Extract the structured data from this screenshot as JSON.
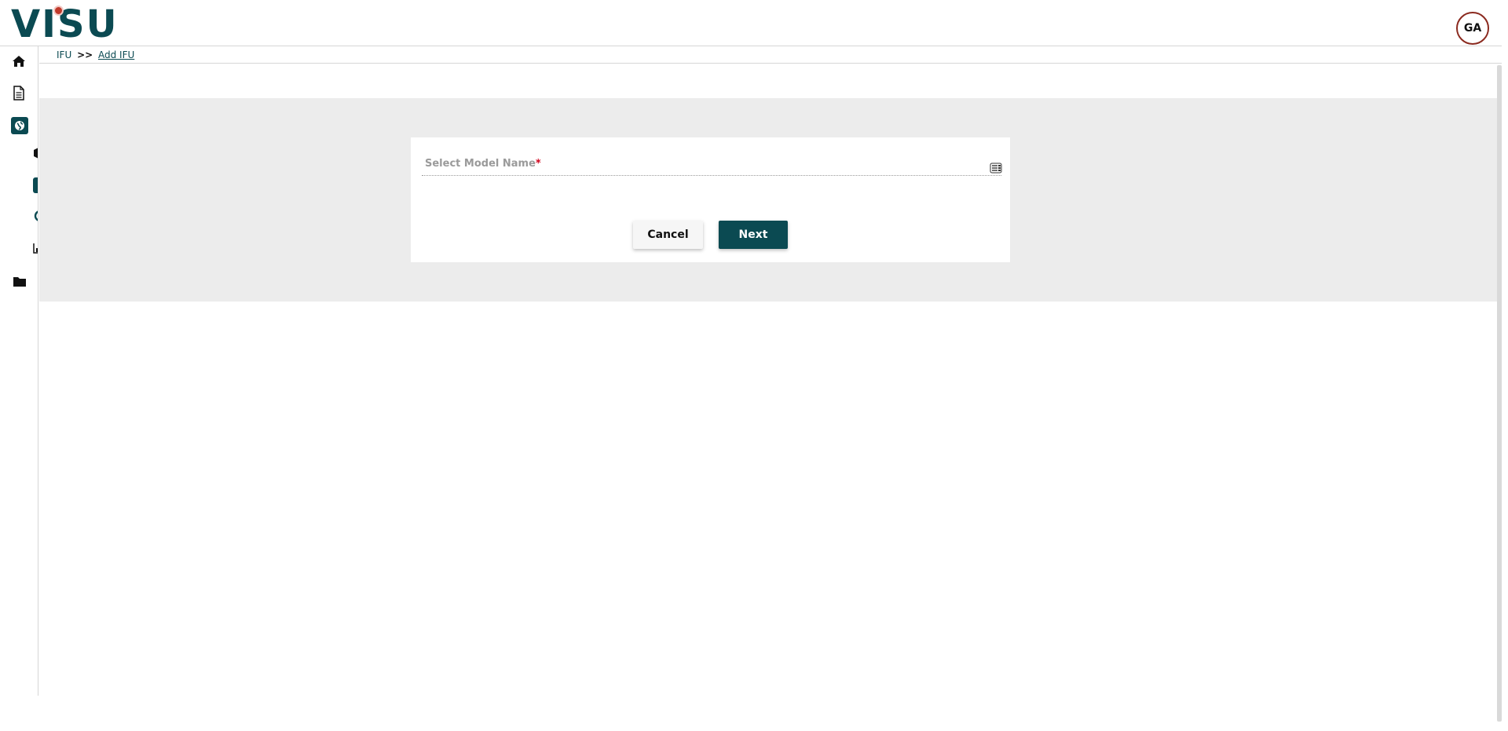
{
  "header": {
    "logo_text": "VISU",
    "avatar_initials": "GA"
  },
  "breadcrumb": {
    "root": "IFU",
    "separator": ">>",
    "current": "Add IFU"
  },
  "form": {
    "model_label": "Select Model Name",
    "required_mark": "*",
    "cancel_label": "Cancel",
    "next_label": "Next"
  },
  "sidebar": {
    "items": [
      {
        "icon": "home-icon"
      },
      {
        "icon": "document-icon"
      },
      {
        "icon": "globe-icon",
        "active": true
      },
      {
        "icon": "box-icon"
      },
      {
        "icon": "circle-icon"
      },
      {
        "icon": "refresh-icon"
      },
      {
        "icon": "chart-icon"
      },
      {
        "icon": "folder-icon"
      }
    ]
  },
  "colors": {
    "brand": "#0b4a52",
    "band": "#ececec",
    "required": "#d0021b"
  }
}
